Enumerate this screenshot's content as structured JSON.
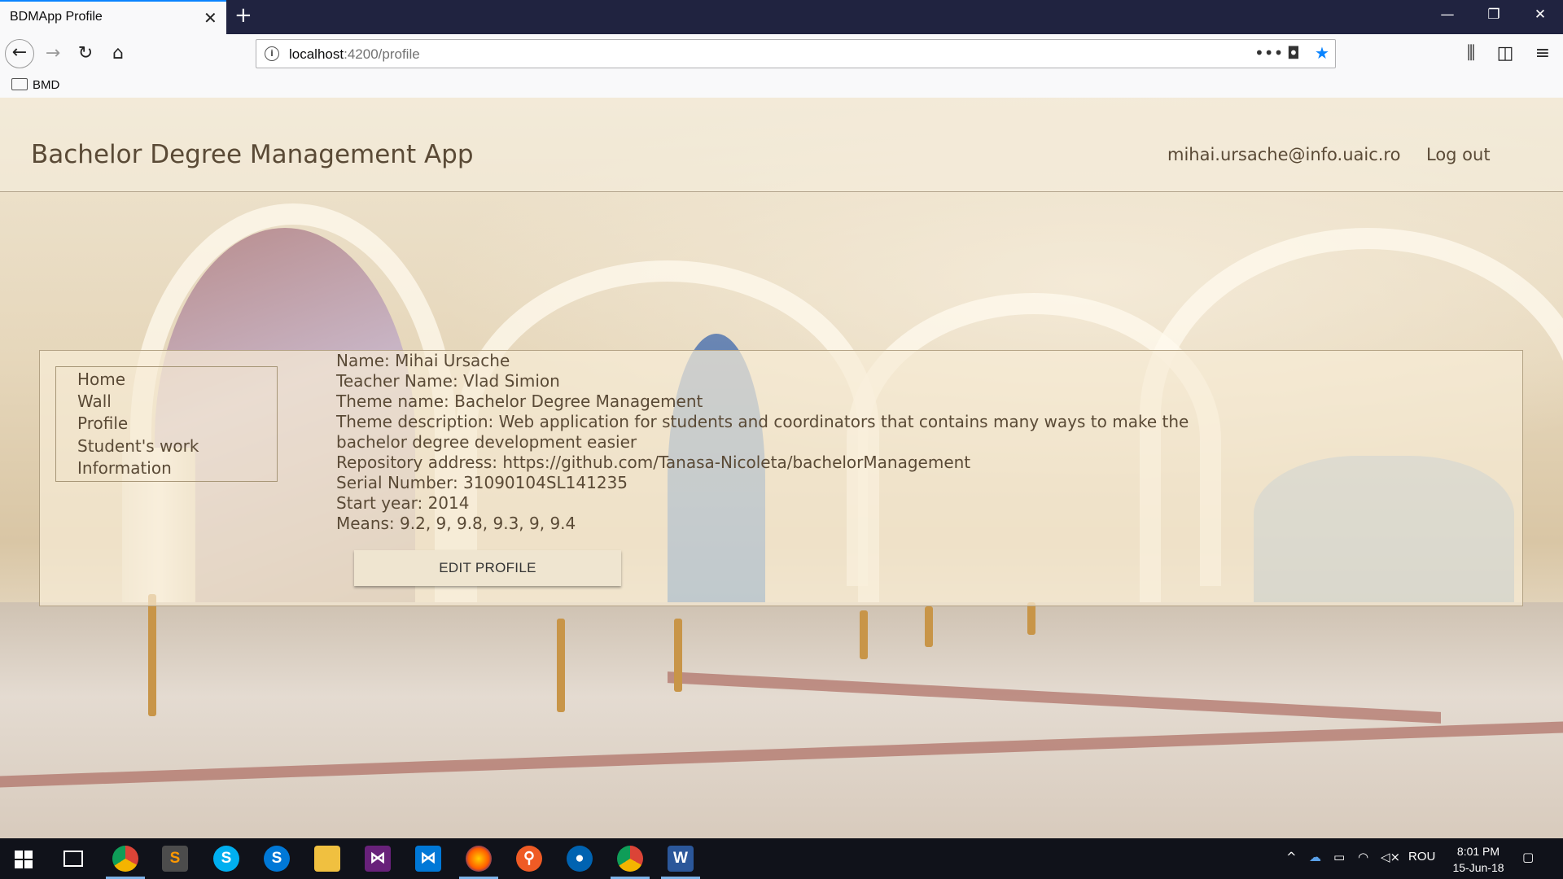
{
  "browser": {
    "tab_title": "BDMApp Profile",
    "tab_close": "✕",
    "new_tab": "+",
    "url_host": "localhost",
    "url_path": ":4200/profile",
    "bookmark_folder": "BMD"
  },
  "header": {
    "title": "Bachelor Degree Management App",
    "user_email": "mihai.ursache@info.uaic.ro",
    "logout_label": "Log out"
  },
  "sidenav": {
    "items": [
      {
        "label": "Home"
      },
      {
        "label": "Wall"
      },
      {
        "label": "Profile"
      },
      {
        "label": "Student's work"
      },
      {
        "label": "Information"
      }
    ]
  },
  "profile": {
    "lines": [
      "Name: Mihai Ursache",
      "Teacher Name: Vlad Simion",
      "Theme name: Bachelor Degree Management",
      "Theme description: Web application for students and coordinators that contains many ways to make the bachelor degree development easier",
      "Repository address: https://github.com/Tanasa-Nicoleta/bachelorManagement",
      "Serial Number: 31090104SL141235",
      "Start year: 2014",
      "Means: 9.2, 9, 9.8, 9.3, 9, 9.4"
    ],
    "edit_button_label": "EDIT PROFILE"
  },
  "taskbar": {
    "language": "ROU",
    "time": "8:01 PM",
    "date": "15-Jun-18",
    "apps": [
      "chrome",
      "sublime",
      "skype",
      "skype-business",
      "file-explorer",
      "visual-studio",
      "vscode",
      "firefox",
      "postman",
      "maps",
      "chrome",
      "word"
    ]
  },
  "colors": {
    "browser_dark": "#202340",
    "accent_blue": "#0a84ff",
    "page_text": "#5a4a36",
    "taskbar": "#10121a"
  }
}
